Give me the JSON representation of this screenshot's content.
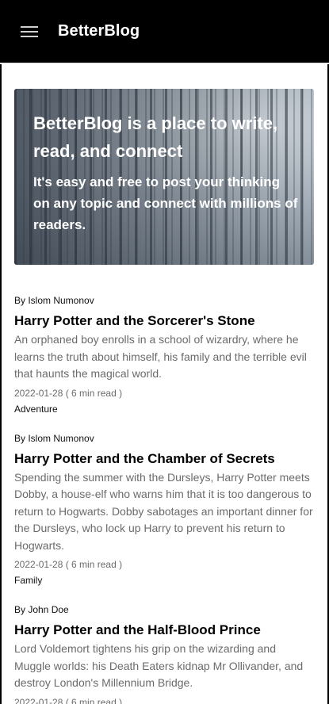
{
  "app": {
    "title": "BetterBlog",
    "menu_icon": "menu-icon"
  },
  "hero": {
    "title": "BetterBlog is a place to write, read, and connect",
    "subtitle": "It's easy and free to post your thinking on any topic and connect with millions of readers."
  },
  "posts": [
    {
      "author": "By Islom Numonov",
      "title": "Harry Potter and the Sorcerer's Stone",
      "excerpt": "An orphaned boy enrolls in a school of wizardry, where he learns the truth about himself, his family and the terrible evil that haunts the magical world.",
      "meta": "2022-01-28 ( 6 min read )",
      "tag": "Adventure"
    },
    {
      "author": "By Islom Numonov",
      "title": "Harry Potter and the Chamber of Secrets",
      "excerpt": "Spending the summer with the Dursleys, Harry Potter meets Dobby, a house-elf who warns him that it is too dangerous to return to Hogwarts. Dobby sabotages an important dinner for the Dursleys, who lock up Harry to prevent his return to Hogwarts.",
      "meta": "2022-01-28 ( 6 min read )",
      "tag": "Family"
    },
    {
      "author": "By John Doe",
      "title": "Harry Potter and the Half-Blood Prince",
      "excerpt": "Lord Voldemort tightens his grip on the wizarding and Muggle worlds: his Death Eaters kidnap Mr Ollivander, and destroy London's Millennium Bridge.",
      "meta": "2022-01-28 ( 6 min read )",
      "tag": ""
    }
  ]
}
